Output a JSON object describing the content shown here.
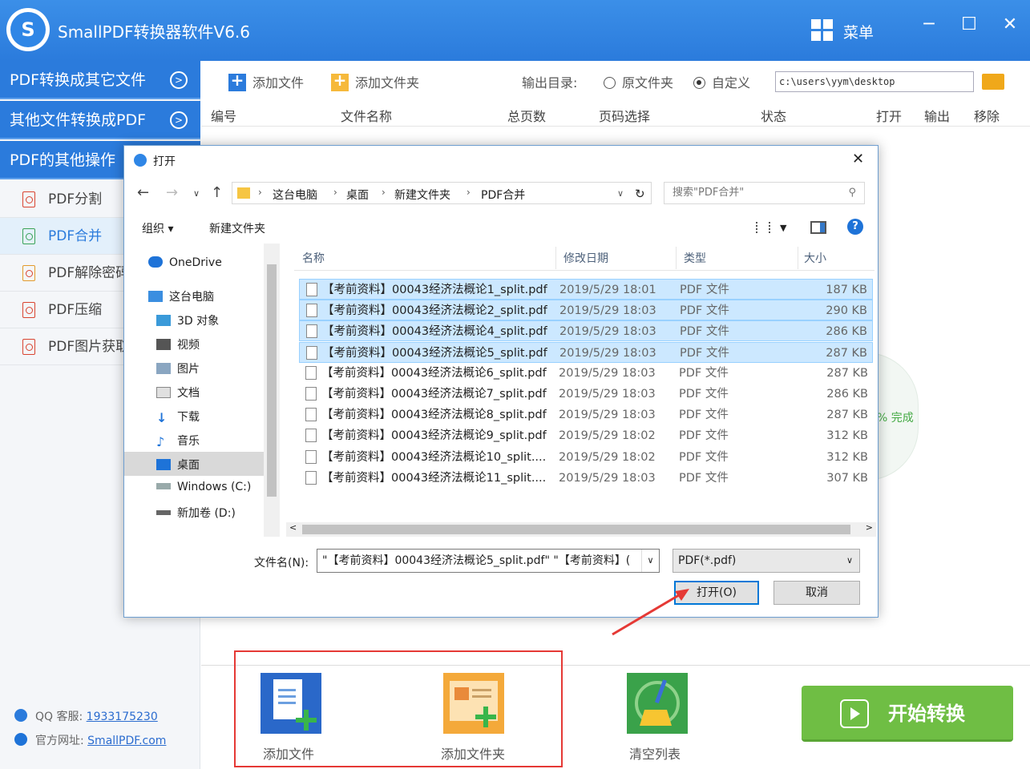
{
  "app": {
    "title": "SmallPDF转换器软件V6.6",
    "menu_label": "菜单",
    "min": "─",
    "max": "☐",
    "close": "✕"
  },
  "sidebar": {
    "categories": [
      {
        "label": "PDF转换成其它文件"
      },
      {
        "label": "其他文件转换成PDF"
      },
      {
        "label": "PDF的其他操作"
      }
    ],
    "items": [
      {
        "label": "PDF分割"
      },
      {
        "label": "PDF合并"
      },
      {
        "label": "PDF解除密码"
      },
      {
        "label": "PDF压缩"
      },
      {
        "label": "PDF图片获取"
      }
    ],
    "qq_label": "QQ 客服:",
    "qq_value": "1933175230",
    "site_label": "官方网址:",
    "site_value": "SmallPDF.com"
  },
  "toolbar": {
    "add_file": "添加文件",
    "add_folder": "添加文件夹",
    "output_label": "输出目录:",
    "radio_original": "原文件夹",
    "radio_custom": "自定义",
    "output_path": "c:\\users\\yym\\desktop"
  },
  "table": {
    "headers": [
      "编号",
      "文件名称",
      "总页数",
      "页码选择",
      "状态",
      "打开",
      "输出",
      "移除"
    ]
  },
  "progress_text": "% 完成",
  "bottom": {
    "add_file": "添加文件",
    "add_folder": "添加文件夹",
    "clear": "清空列表",
    "start": "开始转换"
  },
  "dialog": {
    "title": "打开",
    "breadcrumb": [
      "这台电脑",
      "桌面",
      "新建文件夹",
      "PDF合并"
    ],
    "search_placeholder": "搜索\"PDF合并\"",
    "cmd_organize": "组织 ▾",
    "cmd_new_folder": "新建文件夹",
    "nav": [
      {
        "label": "OneDrive",
        "icon": "cloud-icon"
      },
      {
        "label": "这台电脑",
        "icon": "computer-icon"
      },
      {
        "label": "3D 对象",
        "icon": "cube-icon"
      },
      {
        "label": "视频",
        "icon": "video-icon"
      },
      {
        "label": "图片",
        "icon": "image-icon"
      },
      {
        "label": "文档",
        "icon": "document-icon"
      },
      {
        "label": "下载",
        "icon": "download-icon"
      },
      {
        "label": "音乐",
        "icon": "music-icon"
      },
      {
        "label": "桌面",
        "icon": "desktop-icon"
      },
      {
        "label": "Windows (C:)",
        "icon": "drive-icon"
      },
      {
        "label": "新加卷 (D:)",
        "icon": "drive-icon"
      }
    ],
    "columns": [
      "名称",
      "修改日期",
      "类型",
      "大小"
    ],
    "files": [
      {
        "name": "【考前资料】00043经济法概论1_split.pdf",
        "date": "2019/5/29 18:01",
        "type": "PDF 文件",
        "size": "187 KB",
        "selected": true
      },
      {
        "name": "【考前资料】00043经济法概论2_split.pdf",
        "date": "2019/5/29 18:03",
        "type": "PDF 文件",
        "size": "290 KB",
        "selected": true
      },
      {
        "name": "【考前资料】00043经济法概论4_split.pdf",
        "date": "2019/5/29 18:03",
        "type": "PDF 文件",
        "size": "286 KB",
        "selected": true
      },
      {
        "name": "【考前资料】00043经济法概论5_split.pdf",
        "date": "2019/5/29 18:03",
        "type": "PDF 文件",
        "size": "287 KB",
        "selected": true
      },
      {
        "name": "【考前资料】00043经济法概论6_split.pdf",
        "date": "2019/5/29 18:03",
        "type": "PDF 文件",
        "size": "287 KB",
        "selected": false
      },
      {
        "name": "【考前资料】00043经济法概论7_split.pdf",
        "date": "2019/5/29 18:03",
        "type": "PDF 文件",
        "size": "286 KB",
        "selected": false
      },
      {
        "name": "【考前资料】00043经济法概论8_split.pdf",
        "date": "2019/5/29 18:03",
        "type": "PDF 文件",
        "size": "287 KB",
        "selected": false
      },
      {
        "name": "【考前资料】00043经济法概论9_split.pdf",
        "date": "2019/5/29 18:02",
        "type": "PDF 文件",
        "size": "312 KB",
        "selected": false
      },
      {
        "name": "【考前资料】00043经济法概论10_split....",
        "date": "2019/5/29 18:02",
        "type": "PDF 文件",
        "size": "312 KB",
        "selected": false
      },
      {
        "name": "【考前资料】00043经济法概论11_split....",
        "date": "2019/5/29 18:03",
        "type": "PDF 文件",
        "size": "307 KB",
        "selected": false
      }
    ],
    "filename_label": "文件名(N):",
    "filename_value": "\"【考前资料】00043经济法概论5_split.pdf\" \"【考前资料】(",
    "filetype_value": "PDF(*.pdf)",
    "open_button": "打开(O)",
    "cancel_button": "取消"
  },
  "colors": {
    "brand_blue": "#2b7bdc",
    "start_green": "#6fbe44",
    "annotation_red": "#e53935"
  }
}
